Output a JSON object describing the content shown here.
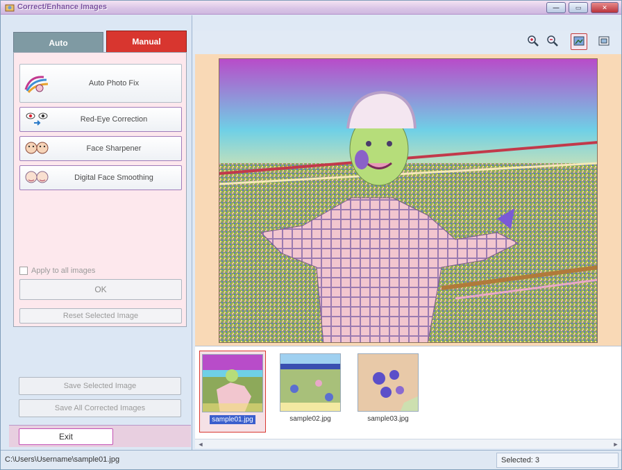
{
  "window": {
    "title": "Correct/Enhance Images",
    "controls": {
      "minimize": "—",
      "maximize": "▭",
      "close": "✕"
    }
  },
  "tabs": {
    "auto": "Auto",
    "manual": "Manual"
  },
  "fixes": [
    {
      "label": "Auto Photo Fix",
      "icon": "auto-photo-fix-icon"
    },
    {
      "label": "Red-Eye Correction",
      "icon": "red-eye-icon"
    },
    {
      "label": "Face Sharpener",
      "icon": "face-sharpener-icon"
    },
    {
      "label": "Digital Face Smoothing",
      "icon": "face-smoothing-icon"
    }
  ],
  "apply_all_label": "Apply to all images",
  "ok_label": "OK",
  "reset_label": "Reset Selected Image",
  "save_selected_label": "Save Selected Image",
  "save_all_label": "Save All Corrected Images",
  "exit_label": "Exit",
  "toolbar": {
    "icons": [
      "zoom-in-icon",
      "zoom-out-icon",
      "full-screen-icon",
      "fit-window-icon"
    ]
  },
  "thumbnails": [
    {
      "caption": "sample01.jpg",
      "selected": true
    },
    {
      "caption": "sample02.jpg",
      "selected": false
    },
    {
      "caption": "sample03.jpg",
      "selected": false
    }
  ],
  "status": {
    "path": "C:\\Users\\Username\\sample01.jpg",
    "selected": "Selected: 3"
  }
}
